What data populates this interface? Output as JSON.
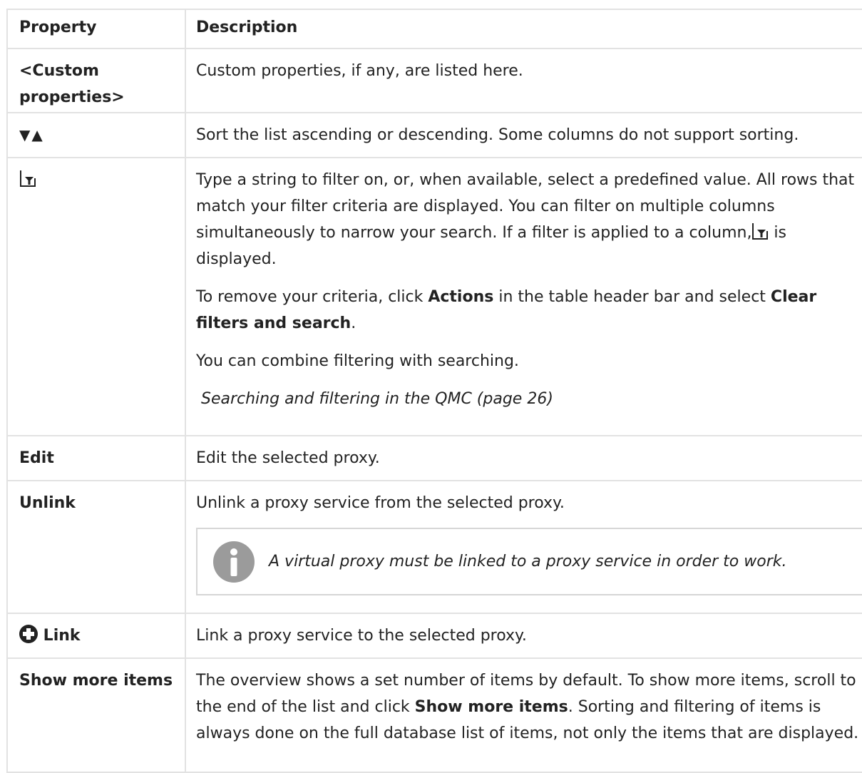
{
  "header": {
    "property": "Property",
    "description": "Description"
  },
  "rows": {
    "custom": {
      "property": "<Custom properties>",
      "description": "Custom properties, if any, are listed here."
    },
    "sort": {
      "property_icon": "sort-triangles-icon",
      "property_glyph": "▼▲",
      "description": "Sort the list ascending or descending. Some columns do not support sorting."
    },
    "filter": {
      "property_icon": "filter-icon",
      "p1_before": "Type a string to filter on, or, when available, select a predefined value. All rows that match your filter criteria are displayed. You can filter on multiple columns simultaneously to narrow your search. If a filter is applied to a column,",
      "p1_after": " is displayed.",
      "p2_before": "To remove your criteria, click ",
      "p2_bold1": "Actions",
      "p2_mid": " in the table header bar and select ",
      "p2_bold2": "Clear filters and search",
      "p2_after": ".",
      "p3": "You can combine filtering with searching.",
      "p4": " Searching and filtering in the QMC (page 26)"
    },
    "edit": {
      "property": "Edit",
      "description": "Edit the selected proxy."
    },
    "unlink": {
      "property": "Unlink",
      "description": "Unlink a proxy service from the selected proxy.",
      "note": "A virtual proxy must be linked to a proxy service in order to work.",
      "note_icon": "info-icon"
    },
    "link": {
      "property": "Link",
      "property_icon": "plus-circle-icon",
      "description": "Link a proxy service to the selected proxy."
    },
    "more": {
      "property": "Show more items",
      "d_before": "The overview shows a set number of items by default. To show more items, scroll to the end of the list and click ",
      "d_bold": "Show more items",
      "d_after": ". Sorting and filtering of items is always done on the full database list of items, not only the items that are displayed."
    }
  }
}
